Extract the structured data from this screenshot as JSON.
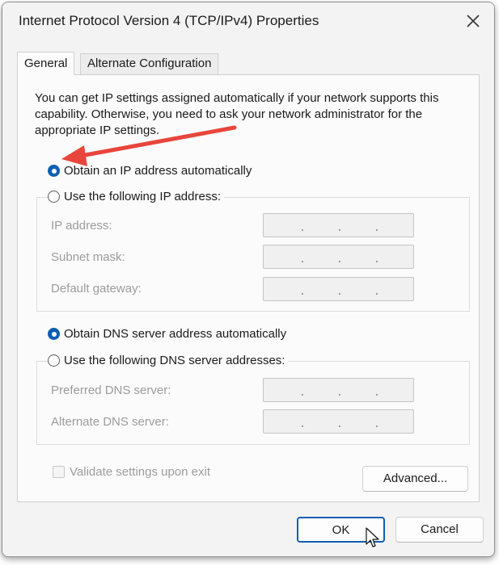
{
  "window": {
    "title": "Internet Protocol Version 4 (TCP/IPv4) Properties"
  },
  "tabs": [
    {
      "label": "General",
      "selected": true
    },
    {
      "label": "Alternate Configuration",
      "selected": false
    }
  ],
  "general": {
    "intro": "You can get IP settings assigned automatically if your network supports this capability. Otherwise, you need to ask your network administrator for the appropriate IP settings.",
    "ip_auto_label": "Obtain an IP address automatically",
    "ip_auto_selected": true,
    "ip_manual_label": "Use the following IP address:",
    "ip_manual_selected": false,
    "ip_fields": [
      {
        "label": "IP address:",
        "value": ""
      },
      {
        "label": "Subnet mask:",
        "value": ""
      },
      {
        "label": "Default gateway:",
        "value": ""
      }
    ],
    "dns_auto_label": "Obtain DNS server address automatically",
    "dns_auto_selected": true,
    "dns_manual_label": "Use the following DNS server addresses:",
    "dns_manual_selected": false,
    "dns_fields": [
      {
        "label": "Preferred DNS server:",
        "value": ""
      },
      {
        "label": "Alternate DNS server:",
        "value": ""
      }
    ],
    "validate_label": "Validate settings upon exit",
    "validate_checked": false,
    "advanced_label": "Advanced..."
  },
  "footer": {
    "ok_label": "OK",
    "cancel_label": "Cancel"
  },
  "colors": {
    "accent": "#0d5fb2",
    "annotation_arrow": "#e8453c",
    "disabled_text": "#9c9c9c"
  }
}
